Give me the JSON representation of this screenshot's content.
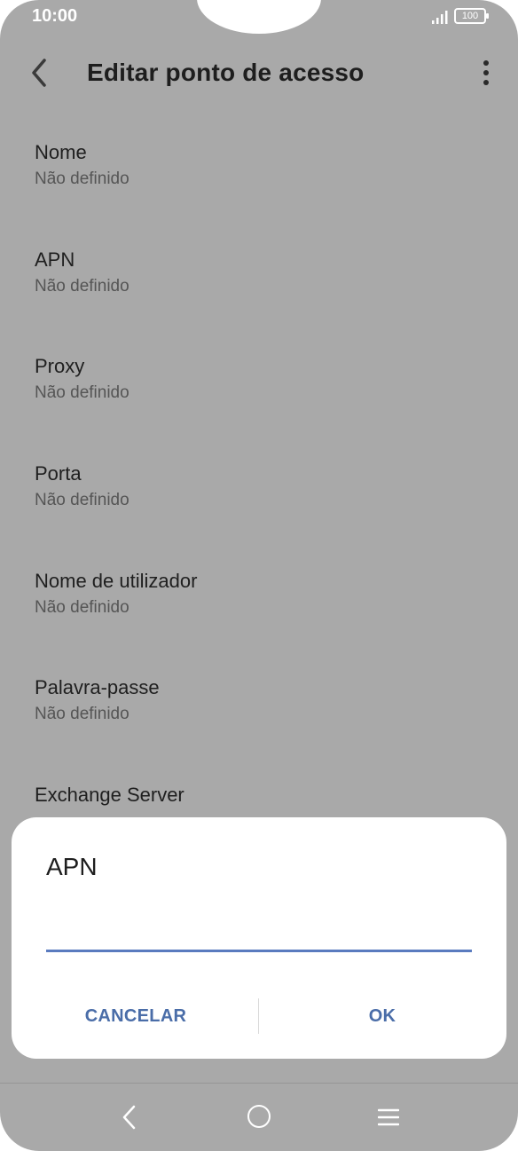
{
  "status_bar": {
    "time": "10:00",
    "battery": "100"
  },
  "app_bar": {
    "title": "Editar ponto de acesso"
  },
  "settings": [
    {
      "label": "Nome",
      "value": "Não definido"
    },
    {
      "label": "APN",
      "value": "Não definido"
    },
    {
      "label": "Proxy",
      "value": "Não definido"
    },
    {
      "label": "Porta",
      "value": "Não definido"
    },
    {
      "label": "Nome de utilizador",
      "value": "Não definido"
    },
    {
      "label": "Palavra-passe",
      "value": "Não definido"
    },
    {
      "label": "Exchange Server",
      "value": ""
    }
  ],
  "dialog": {
    "title": "APN",
    "input_value": "",
    "cancel_label": "CANCELAR",
    "ok_label": "OK"
  },
  "colors": {
    "scrim": "#a9a9a9",
    "accent": "#4a6da8",
    "input_underline": "#5a7bbf"
  },
  "icons": {
    "back": "chevron-left-icon",
    "more": "more-vert-icon",
    "signal": "signal-icon",
    "battery": "battery-icon",
    "nav_back": "nav-back-icon",
    "nav_home": "nav-home-icon",
    "nav_recents": "nav-menu-icon"
  }
}
